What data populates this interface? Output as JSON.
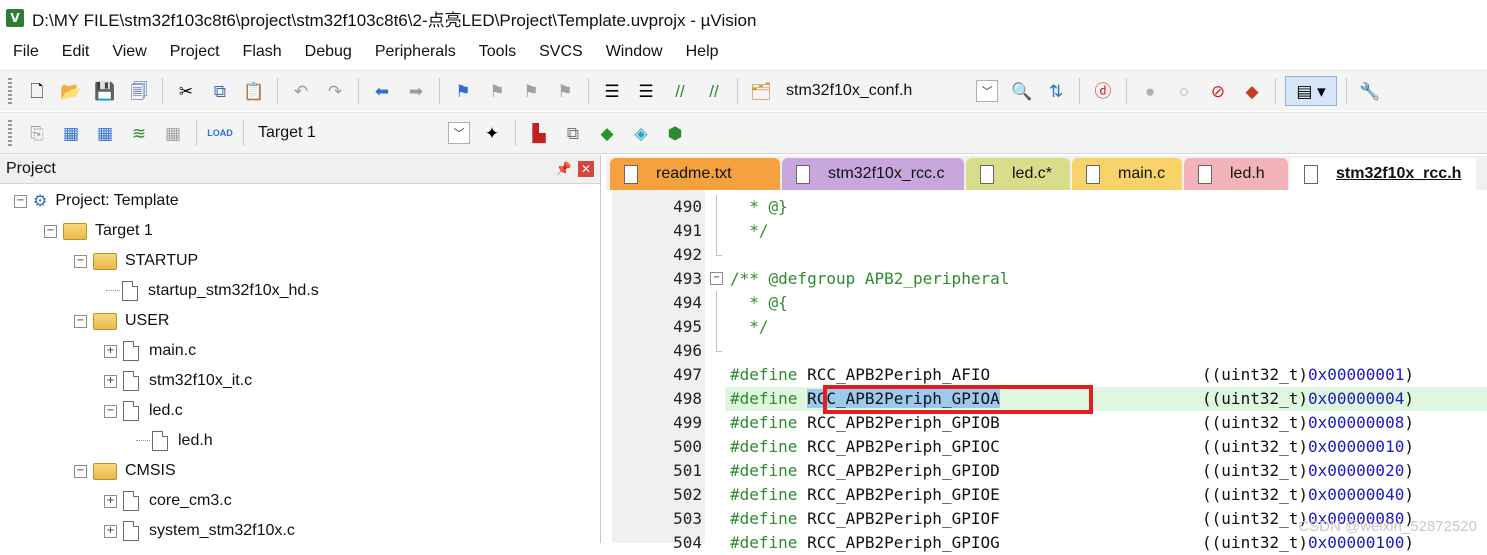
{
  "window": {
    "title": "D:\\MY FILE\\stm32f103c8t6\\project\\stm32f103c8t6\\2-点亮LED\\Project\\Template.uvprojx - µVision"
  },
  "menu": [
    "File",
    "Edit",
    "View",
    "Project",
    "Flash",
    "Debug",
    "Peripherals",
    "Tools",
    "SVCS",
    "Window",
    "Help"
  ],
  "toolbar": {
    "file_combo": "stm32f10x_conf.h",
    "target_combo": "Target 1",
    "load_label": "LOAD"
  },
  "project_panel": {
    "title": "Project",
    "nodes": {
      "project": "Project: Template",
      "target": "Target 1",
      "startup": "STARTUP",
      "startup_file": "startup_stm32f10x_hd.s",
      "user": "USER",
      "main_c": "main.c",
      "it_c": "stm32f10x_it.c",
      "led_c": "led.c",
      "led_h": "led.h",
      "cmsis": "CMSIS",
      "core_c": "core_cm3.c",
      "system_c": "system_stm32f10x.c"
    }
  },
  "tabs": [
    {
      "label": "readme.txt",
      "color": "#f5a23e"
    },
    {
      "label": "stm32f10x_rcc.c",
      "color": "#c8a8dc"
    },
    {
      "label": "led.c*",
      "color": "#d9dc8a"
    },
    {
      "label": "main.c",
      "color": "#f7d36a"
    },
    {
      "label": "led.h",
      "color": "#f3b4b9"
    },
    {
      "label": "stm32f10x_rcc.h",
      "color": "#ffffff"
    }
  ],
  "editor": {
    "lines": [
      {
        "n": "490",
        "text": "  * @}"
      },
      {
        "n": "491",
        "text": "  */"
      },
      {
        "n": "492",
        "text": ""
      },
      {
        "n": "493",
        "text": "/** @defgroup APB2_peripheral"
      },
      {
        "n": "494",
        "text": "  * @{"
      },
      {
        "n": "495",
        "text": "  */"
      },
      {
        "n": "496",
        "text": ""
      },
      {
        "n": "497",
        "kw": "#define",
        "name": "RCC_APB2Periph_AFIO",
        "cast": "((uint32_t)",
        "hex": "0x00000001",
        "close": ")"
      },
      {
        "n": "498",
        "kw": "#define",
        "name": "RCC_APB2Periph_GPIOA",
        "cast": "((uint32_t)",
        "hex": "0x00000004",
        "close": ")"
      },
      {
        "n": "499",
        "kw": "#define",
        "name": "RCC_APB2Periph_GPIOB",
        "cast": "((uint32_t)",
        "hex": "0x00000008",
        "close": ")"
      },
      {
        "n": "500",
        "kw": "#define",
        "name": "RCC_APB2Periph_GPIOC",
        "cast": "((uint32_t)",
        "hex": "0x00000010",
        "close": ")"
      },
      {
        "n": "501",
        "kw": "#define",
        "name": "RCC_APB2Periph_GPIOD",
        "cast": "((uint32_t)",
        "hex": "0x00000020",
        "close": ")"
      },
      {
        "n": "502",
        "kw": "#define",
        "name": "RCC_APB2Periph_GPIOE",
        "cast": "((uint32_t)",
        "hex": "0x00000040",
        "close": ")"
      },
      {
        "n": "503",
        "kw": "#define",
        "name": "RCC_APB2Periph_GPIOF",
        "cast": "((uint32_t)",
        "hex": "0x00000080",
        "close": ")"
      },
      {
        "n": "504",
        "kw": "#define",
        "name": "RCC_APB2Periph_GPIOG",
        "cast": "((uint32_t)",
        "hex": "0x00000100",
        "close": ")"
      }
    ]
  },
  "watermark": "CSDN @weixin_52872520"
}
